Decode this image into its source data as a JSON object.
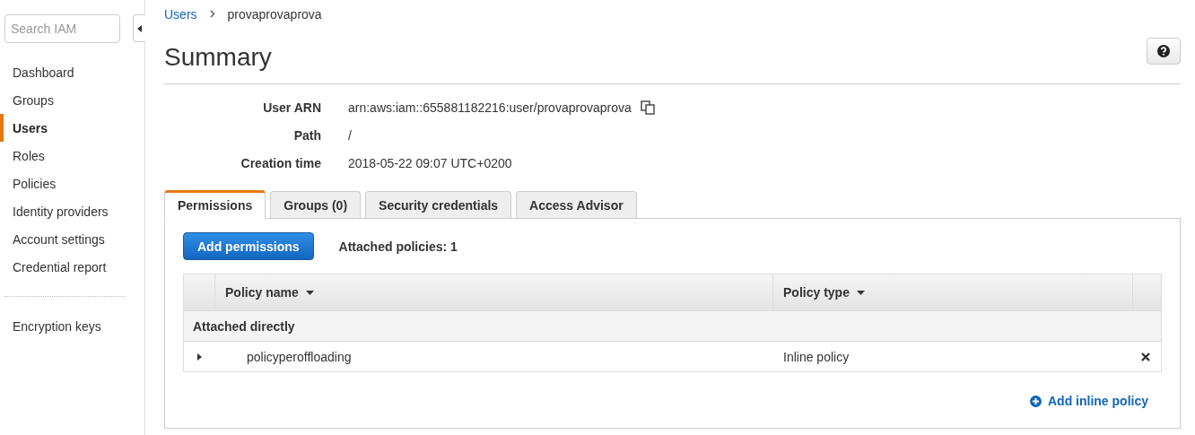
{
  "sidebar": {
    "search": {
      "placeholder": "Search IAM"
    },
    "items": [
      {
        "label": "Dashboard",
        "selected": false
      },
      {
        "label": "Groups",
        "selected": false
      },
      {
        "label": "Users",
        "selected": true
      },
      {
        "label": "Roles",
        "selected": false
      },
      {
        "label": "Policies",
        "selected": false
      },
      {
        "label": "Identity providers",
        "selected": false
      },
      {
        "label": "Account settings",
        "selected": false
      },
      {
        "label": "Credential report",
        "selected": false
      }
    ],
    "extra_items": [
      {
        "label": "Encryption keys",
        "selected": false
      }
    ]
  },
  "breadcrumb": [
    "Users",
    "provaprovaprova"
  ],
  "title": "Summary",
  "details": [
    {
      "label": "User ARN",
      "value": "arn:aws:iam::655881182216:user/provaprovaprova",
      "copyable": true
    },
    {
      "label": "Path",
      "value": "/",
      "copyable": false
    },
    {
      "label": "Creation time",
      "value": "2018-05-22 09:07 UTC+0200",
      "copyable": false
    }
  ],
  "tabs": [
    {
      "label": "Permissions",
      "selected": true
    },
    {
      "label": "Groups (0)",
      "selected": false
    },
    {
      "label": "Security credentials",
      "selected": false
    },
    {
      "label": "Access Advisor",
      "selected": false
    }
  ],
  "permissions": {
    "add_button": "Add permissions",
    "attached_count": "Attached policies: 1",
    "table": {
      "columns": [
        "Policy name",
        "Policy type"
      ],
      "groups": [
        {
          "label": "Attached directly",
          "rows": [
            {
              "name": "policyperoffloading",
              "type": "Inline policy",
              "expanded": false
            }
          ]
        }
      ]
    },
    "add_inline": "Add inline policy"
  }
}
